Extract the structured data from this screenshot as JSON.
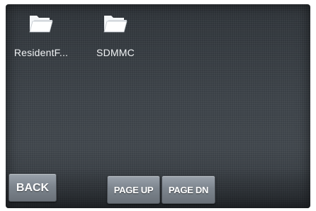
{
  "files": [
    {
      "name": "ResidentF...",
      "icon": "folder-icon"
    },
    {
      "name": "SDMMC",
      "icon": "folder-icon"
    }
  ],
  "buttons": {
    "back": "BACK",
    "page_up": "PAGE UP",
    "page_dn": "PAGE DN"
  },
  "colors": {
    "screen_bg": "#3b4147",
    "button_bg": "#7d858e",
    "text": "#f0f2f4"
  }
}
